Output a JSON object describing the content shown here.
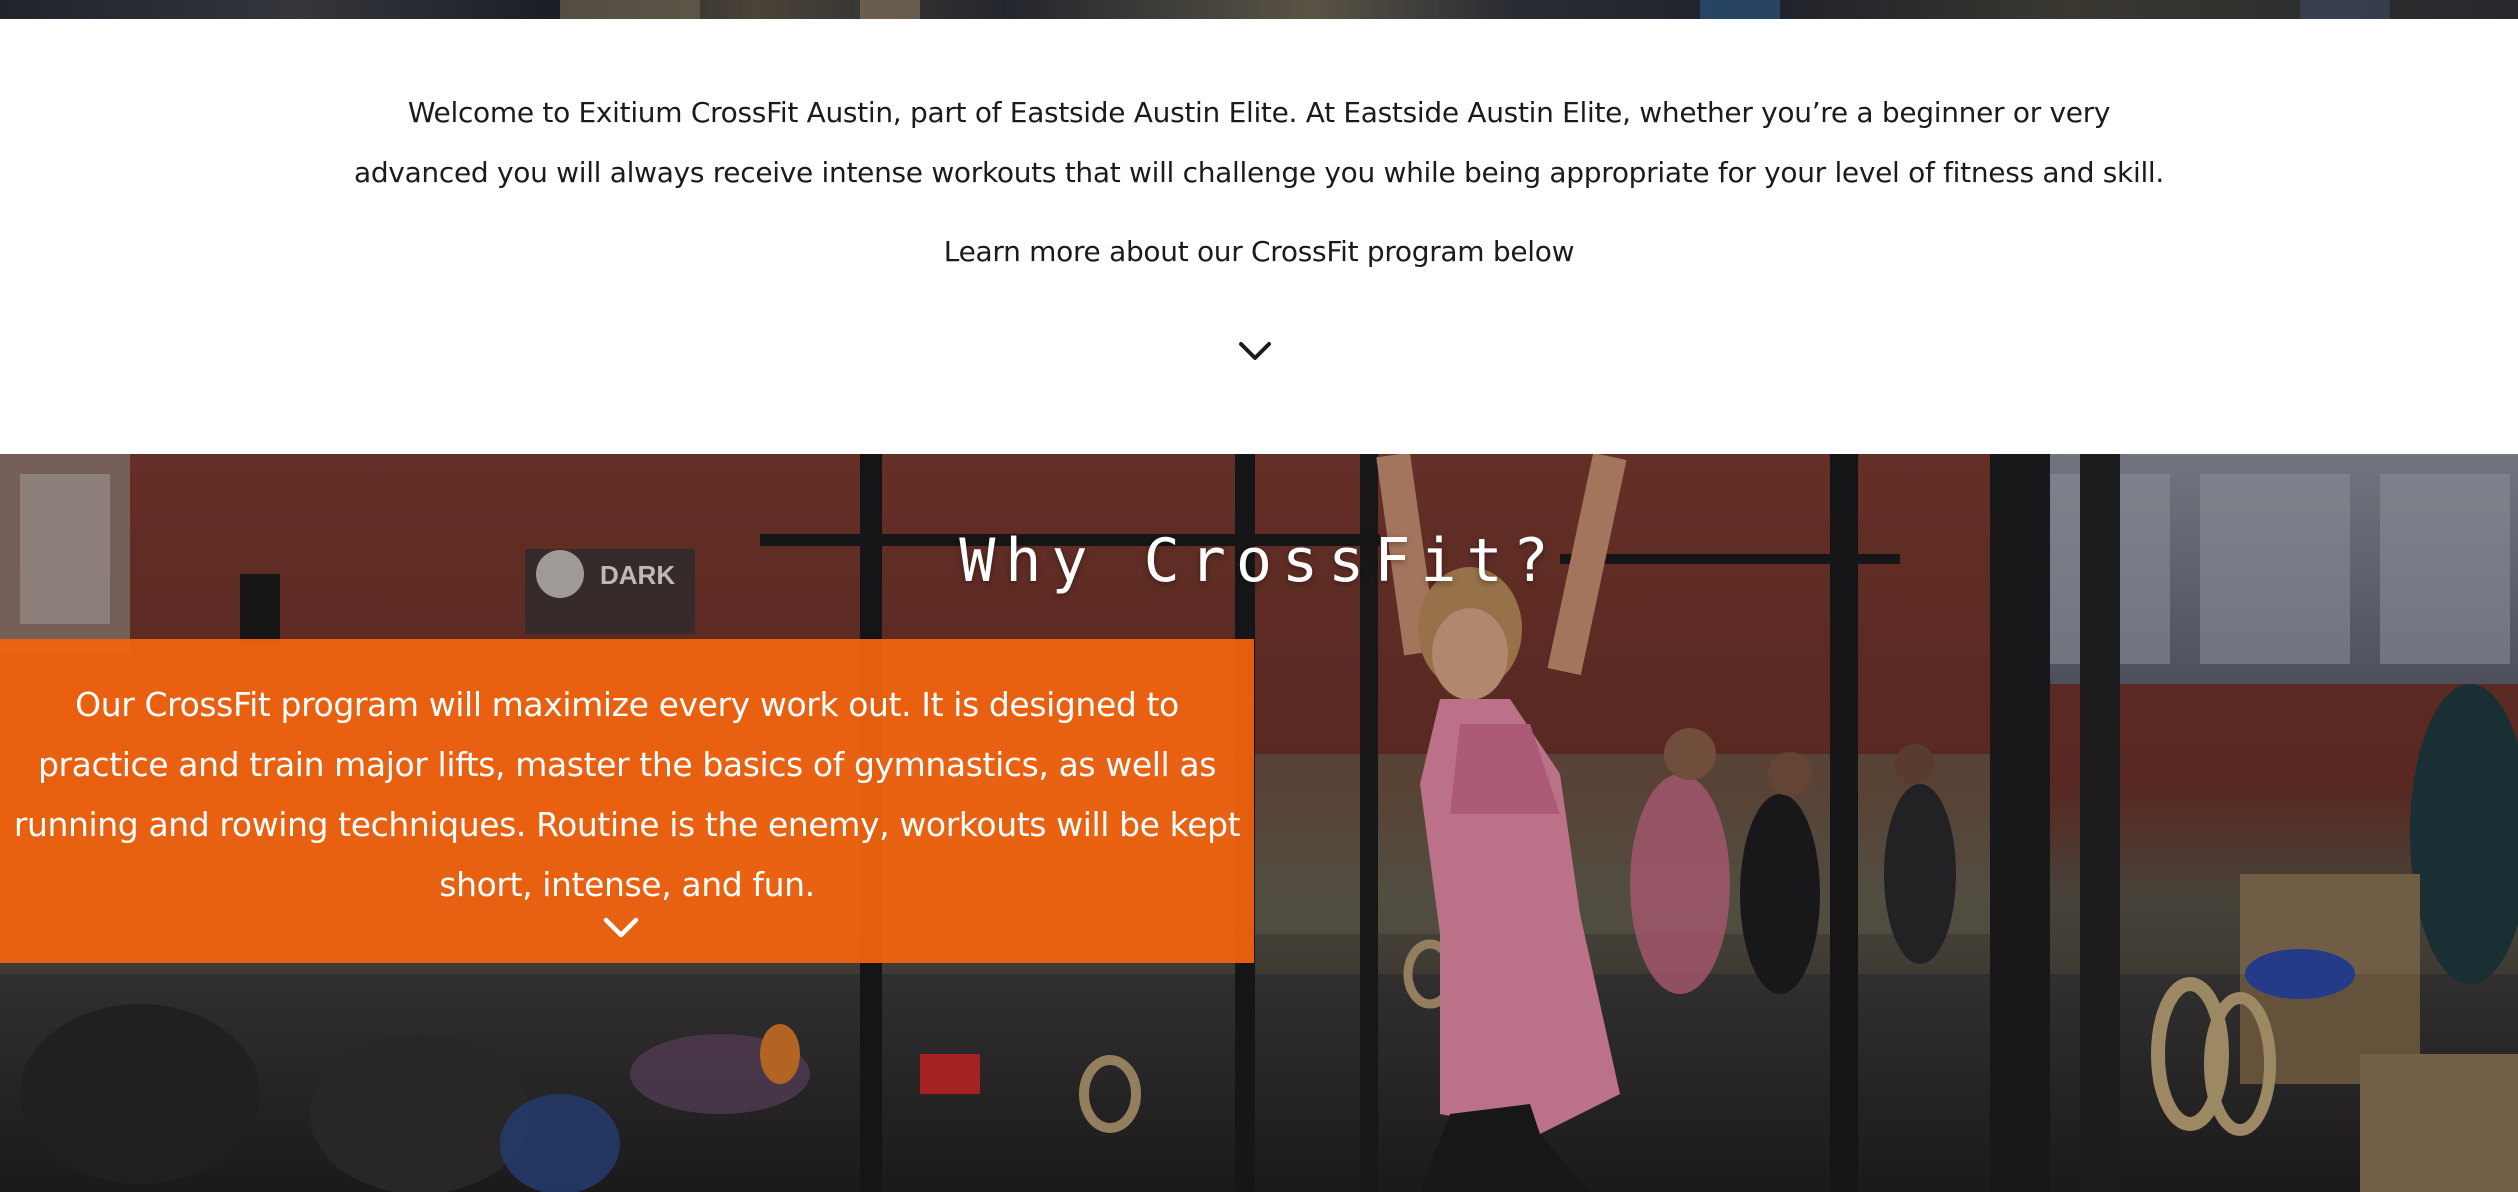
{
  "welcome": {
    "paragraph": "Welcome to Exitium CrossFit Austin, part of Eastside Austin Elite. At Eastside Austin Elite, whether you’re a beginner or very advanced you will always receive intense workouts that will challenge you while being appropriate for your level of fitness and skill.",
    "learn_more": "Learn more about our CrossFit program below",
    "scroll_icon": "chevron-down-icon"
  },
  "hero": {
    "title": "Why CrossFit?",
    "description": "Our CrossFit program will maximize every work out. It is designed to practice and train major lifts, master the basics of gymnastics, as well as running and rowing techniques. Routine is the enemy, workouts will be kept short, intense, and fun.",
    "scroll_icon": "chevron-down-icon",
    "gym_sign_text": "DARK",
    "accent_color": "#f4640f"
  }
}
